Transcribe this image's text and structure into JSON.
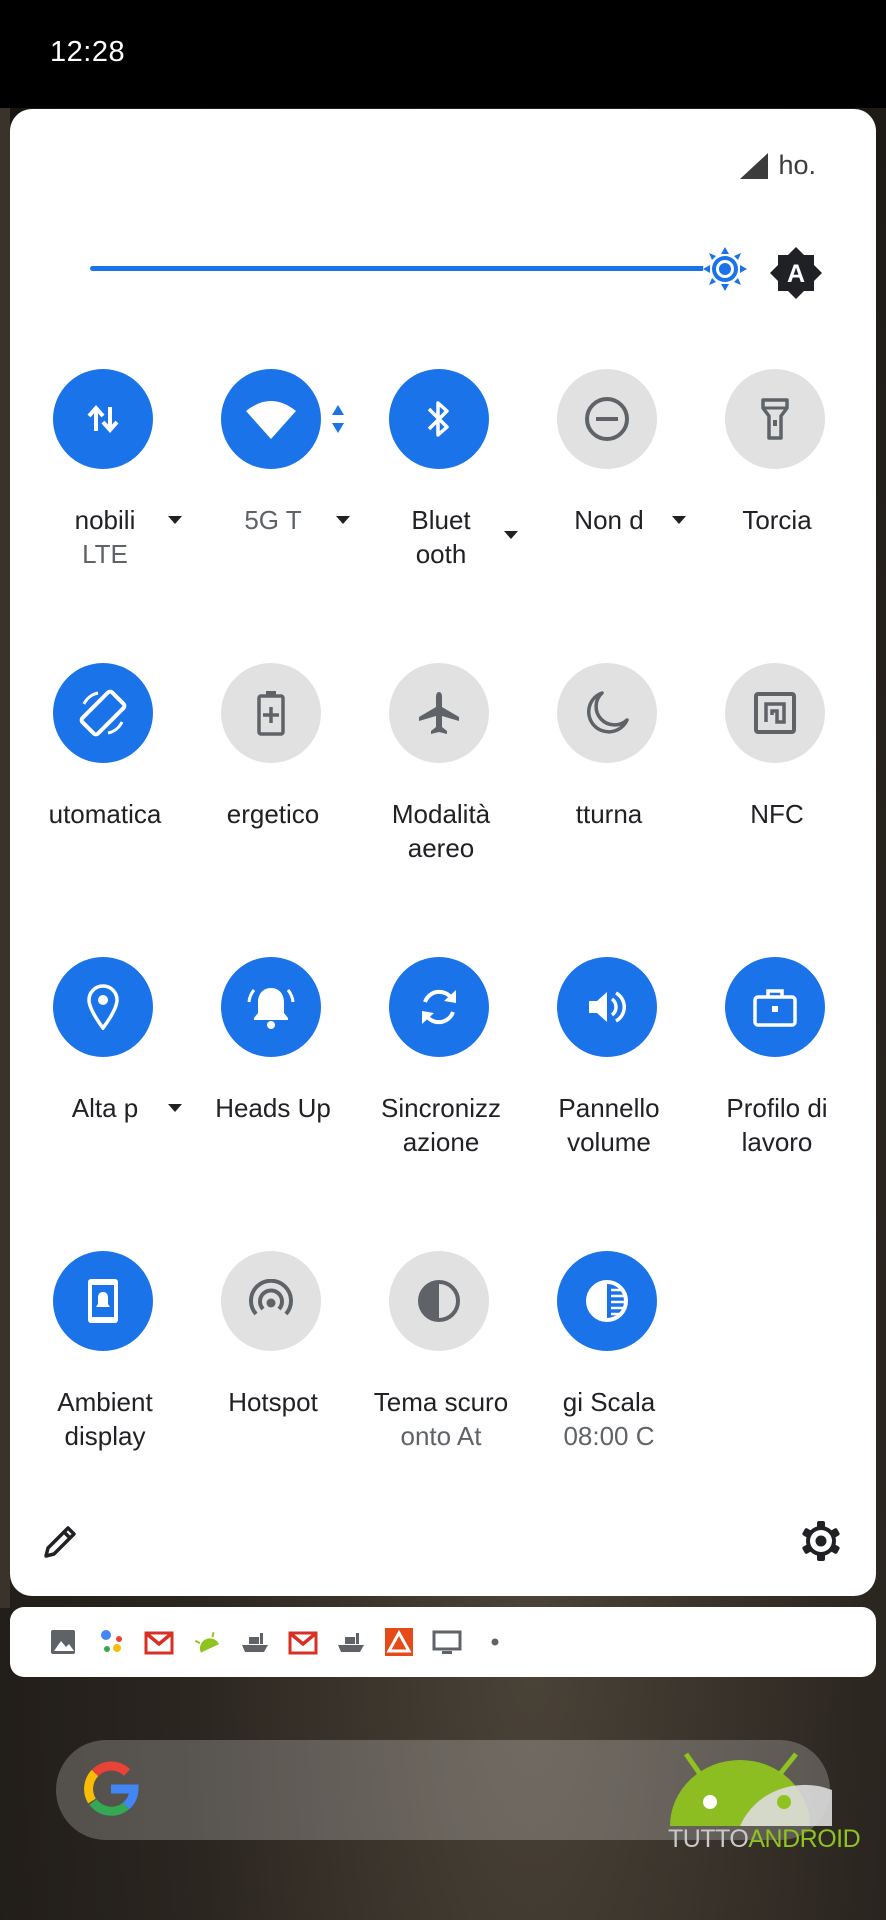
{
  "status_bar": {
    "time": "12:28"
  },
  "quick_settings": {
    "carrier": "ho.",
    "brightness_level": 0.93,
    "auto_brightness_letter": "A",
    "accent_color": "#1a73e8",
    "tiles": [
      {
        "label": "nobili",
        "secondary": "LTE",
        "state": "on",
        "icon": "mobile-data-icon"
      },
      {
        "label": "5G   T",
        "secondary": "",
        "state": "on",
        "icon": "wifi-icon"
      },
      {
        "label": "Bluet",
        "secondary": "ooth",
        "state": "on",
        "icon": "bluetooth-icon"
      },
      {
        "label": "Non d",
        "secondary": "",
        "state": "off",
        "icon": "do-not-disturb-icon"
      },
      {
        "label": "Torcia",
        "secondary": "",
        "state": "off",
        "icon": "flashlight-icon"
      },
      {
        "label": "utomatica",
        "secondary": "",
        "state": "on",
        "icon": "auto-rotate-icon"
      },
      {
        "label": "ergetico",
        "secondary": "",
        "state": "off",
        "icon": "battery-saver-icon"
      },
      {
        "label": "Modalità",
        "secondary": "aereo",
        "state": "off",
        "icon": "airplane-icon"
      },
      {
        "label": "tturna",
        "secondary": "",
        "state": "off",
        "icon": "night-light-icon"
      },
      {
        "label": "NFC",
        "secondary": "",
        "state": "off",
        "icon": "nfc-icon"
      },
      {
        "label": "Alta p",
        "secondary": "",
        "state": "on",
        "icon": "location-icon"
      },
      {
        "label": "Heads Up",
        "secondary": "",
        "state": "on",
        "icon": "bell-icon"
      },
      {
        "label": "Sincronizz",
        "secondary": "azione",
        "state": "on",
        "icon": "sync-icon"
      },
      {
        "label": "Pannello",
        "secondary": "volume",
        "state": "on",
        "icon": "volume-icon"
      },
      {
        "label": "Profilo di",
        "secondary": "lavoro",
        "state": "on",
        "icon": "work-profile-icon"
      },
      {
        "label": "Ambient",
        "secondary": "display",
        "state": "on",
        "icon": "ambient-display-icon"
      },
      {
        "label": "Hotspot",
        "secondary": "",
        "state": "off",
        "icon": "hotspot-icon"
      },
      {
        "label": "Tema scuro",
        "secondary": "onto   At",
        "state": "off",
        "icon": "dark-theme-icon"
      },
      {
        "label": "gi      Scala",
        "secondary": "08:00    C",
        "state": "on",
        "icon": "grayscale-icon"
      }
    ]
  },
  "notification_icons": [
    "gallery-icon",
    "assistant-icon",
    "gmail-icon",
    "android-icon",
    "ship-icon",
    "gmail-icon",
    "ship-icon",
    "app-icon",
    "cast-icon",
    "more-dot-icon"
  ],
  "watermark": {
    "part1": "TUTTO",
    "part2": "ANDROID"
  }
}
